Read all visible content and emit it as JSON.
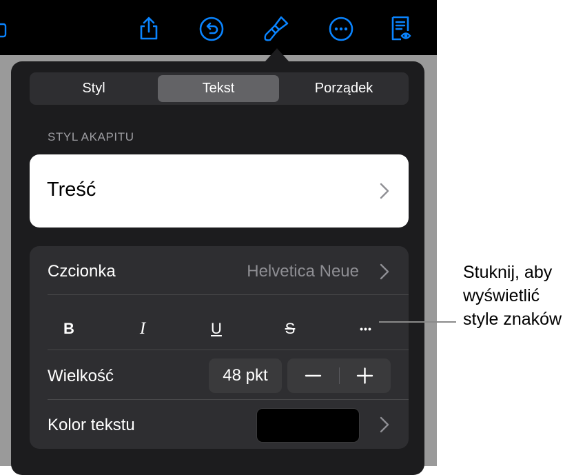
{
  "toolbar": {
    "icons": [
      "share-icon",
      "undo-icon",
      "format-brush-icon",
      "more-icon",
      "reader-view-icon"
    ],
    "accent_color": "#0a84ff"
  },
  "popover": {
    "tabs": [
      {
        "label": "Styl",
        "active": false
      },
      {
        "label": "Tekst",
        "active": true
      },
      {
        "label": "Porządek",
        "active": false
      }
    ],
    "paragraph_style": {
      "section_label": "STYL AKAPITU",
      "value": "Treść"
    },
    "font": {
      "label": "Czcionka",
      "value": "Helvetica Neue"
    },
    "format_buttons": [
      {
        "name": "bold-button",
        "label": "B"
      },
      {
        "name": "italic-button",
        "label": "I"
      },
      {
        "name": "underline-button",
        "label": "U"
      },
      {
        "name": "strikethrough-button",
        "label": "S"
      },
      {
        "name": "more-styles-button",
        "label": "•••"
      }
    ],
    "size": {
      "label": "Wielkość",
      "value": "48 pkt"
    },
    "text_color": {
      "label": "Kolor tekstu",
      "swatch": "#000000"
    }
  },
  "callout": {
    "lines": [
      "Stuknij, aby",
      "wyświetlić",
      "style znaków"
    ]
  }
}
